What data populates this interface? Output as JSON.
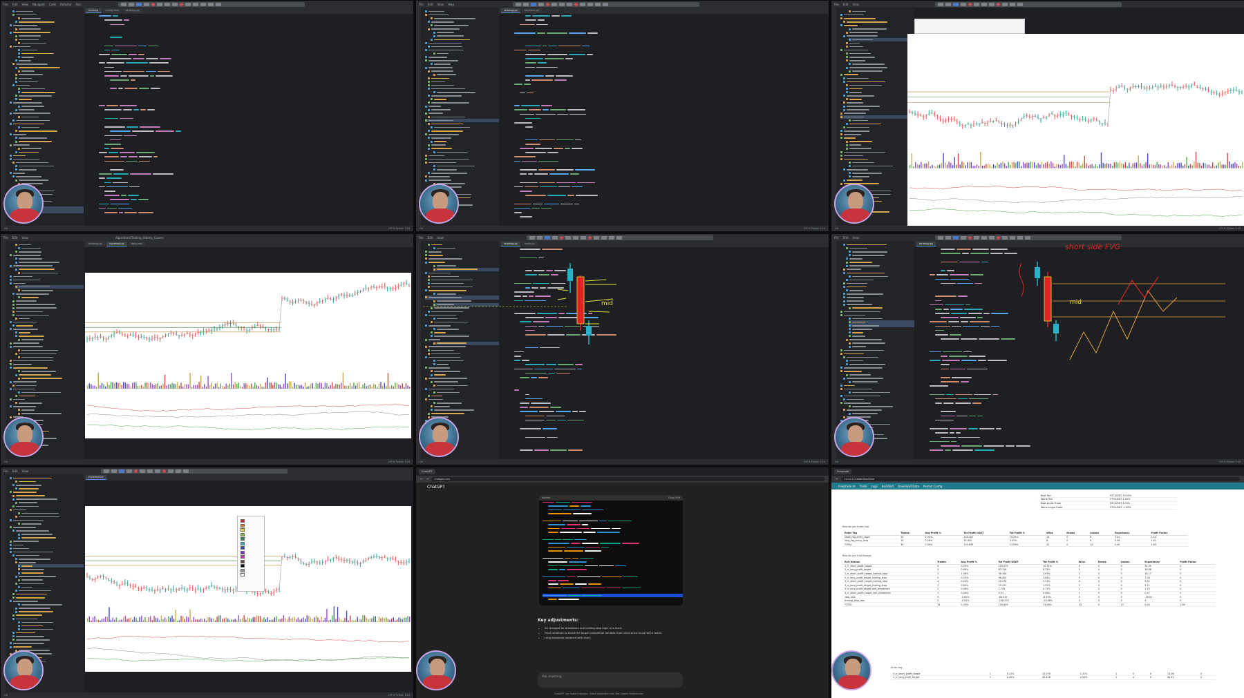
{
  "ide": {
    "menu": [
      "File",
      "Edit",
      "View",
      "Navigate",
      "Code",
      "Refactor",
      "Build",
      "Run",
      "Tools",
      "Git",
      "Window",
      "Help"
    ],
    "tabs_a": [
      "main.py",
      "config.json",
      "strategy.py",
      "backtest.py"
    ],
    "tabs_b": [
      "AlgorithmicTrading_Udemy_Course",
      "strategy.py",
      "hyperopt.py",
      "data.json"
    ],
    "status_left": "Git",
    "status_right": "UTF-8  Python 3.10"
  },
  "chatgpt": {
    "tab_title": "ChatGPT",
    "url": "chatgpt.com",
    "header": "ChatGPT",
    "code_lang": "python",
    "copy_label": "Copy",
    "edit_label": "Edit",
    "heading": "Key adjustments:",
    "bullets": [
      "All changed for breakeven and trailing stop logic in a short.",
      "Final condition to check for target completion handles from  since price must fall to reach.",
      "Long keywords replaced with short."
    ],
    "input_placeholder": "Ask anything",
    "footer": "ChatGPT can make mistakes. Check important info. See Cookie Preferences."
  },
  "freqtrade": {
    "tab_title": "Freqtrade",
    "url": "127.0.0.1:8080/backtest",
    "nav": [
      "Freqtrade UI",
      "Trade",
      "Logs",
      "Backtest",
      "Download Data",
      "Pairlist Config"
    ],
    "metrics": [
      {
        "k": "Best Pair",
        "v": "BTC/USDT 10.00%"
      },
      {
        "k": "Worst Pair",
        "v": "ETH/USDT 1.00%"
      },
      {
        "k": "Best single Trade",
        "v": "BTC/USDT 3.00%"
      },
      {
        "k": "Worst single Trade",
        "v": "ETH/USDT -1.00%"
      }
    ],
    "enter_title": "Results per Enter tag",
    "enter_headers": [
      "Enter Tag",
      "Trades",
      "Avg Profit %",
      "Tot Profit USDT",
      "Tot Profit %",
      "Wins",
      "Draws",
      "Losses",
      "Expectancy",
      "Profit Factor"
    ],
    "enter_rows": [
      [
        "short_fvg_entry_short",
        "20",
        "0.32%",
        "100.187",
        "10.02%",
        "14",
        "0",
        "6",
        "0.41",
        "2.03"
      ],
      [
        "long_fvg_entry_long",
        "14",
        "0.28%",
        "35.452",
        "3.55%",
        "8",
        "0",
        "6",
        "0.36",
        "1.61"
      ],
      [
        "TOTAL",
        "34",
        "0.30%",
        "135.639",
        "13.56%",
        "22",
        "0",
        "12",
        "0.40",
        "1.85"
      ]
    ],
    "exit_title": "Results per Exit Reason",
    "exit_headers": [
      "Exit Reason",
      "Trades",
      "Avg Profit %",
      "Tot Profit USDT",
      "Tot Profit %",
      "Wins",
      "Draws",
      "Losses",
      "Expectancy",
      "Profit Factor"
    ],
    "exit_rows": [
      [
        "1_rr_short_profit_target",
        "9",
        "0.29%",
        "103.079",
        "10.31%",
        "9",
        "0",
        "0",
        "34.35",
        "0"
      ],
      [
        "1_rr_long_profit_target",
        "5",
        "0.69%",
        "83.316",
        "8.33%",
        "5",
        "0",
        "0",
        "16.66",
        "0"
      ],
      [
        "2_rr_short_profit_target_trailing_stop",
        "2",
        "1.08%",
        "36.334",
        "3.63%",
        "2",
        "0",
        "0",
        "18.17",
        "0"
      ],
      [
        "2_rr_long_profit_target_trailing_stop",
        "5",
        "0.53%",
        "36.405",
        "3.64%",
        "5",
        "0",
        "0",
        "7.28",
        "0"
      ],
      [
        "3_rr_short_profit_target_trailing_stop",
        "4",
        "0.24%",
        "22.078",
        "2.21%",
        "4",
        "0",
        "0",
        "5.52",
        "0"
      ],
      [
        "3_rr_long_profit_target_trailing_stop",
        "2",
        "0.69%",
        "10.221",
        "1.02%",
        "2",
        "0",
        "0",
        "5.11",
        "0"
      ],
      [
        "3_rr_long_profit_target_exit_breakeven",
        "1",
        "0.06%",
        "1.745",
        "0.17%",
        "1",
        "0",
        "0",
        "1.75",
        "0"
      ],
      [
        "3_rr_short_profit_target_exit_breakeven",
        "1",
        "0.04%",
        "0.57",
        "0.06%",
        "1",
        "0",
        "0",
        "0.57",
        "0"
      ],
      [
        "stop_loss",
        "5",
        "-0.82%",
        "-84.537",
        "-8.45%",
        "0",
        "0",
        "5",
        "-16.91",
        "0"
      ],
      [
        "trailing_stop_loss",
        "0",
        "-4.55%",
        "-106.575",
        "-10.66%",
        "0",
        "0",
        "0",
        "0",
        "0"
      ],
      [
        "TOTAL",
        "34",
        "0.30%",
        "135.639",
        "13.56%",
        "22",
        "0",
        "12",
        "0.40",
        "1.85"
      ]
    ],
    "enter_title_2": "Enter tag",
    "enter_rows_2": [
      [
        "5_rr_short_profit_target",
        "1",
        "0.22%",
        "13.076",
        "1.31%",
        "1",
        "0",
        "0",
        "13.08",
        "0"
      ],
      [
        "1_rr_long_profit_target",
        "1",
        "0.45%",
        "45.418",
        "4.54%",
        "1",
        "0",
        "0",
        "45.42",
        "0"
      ]
    ]
  },
  "annotations": {
    "mid": "mid",
    "short_title": "short side FVG"
  },
  "colors": {
    "ide_bg": "#1e1f22",
    "candle_red": "#e02424",
    "annotation_yellow": "#e8e63a",
    "candle_teal": "#2ab0c8",
    "freqtrade_nav": "#1f7a8c",
    "chat_bg": "#212121"
  }
}
